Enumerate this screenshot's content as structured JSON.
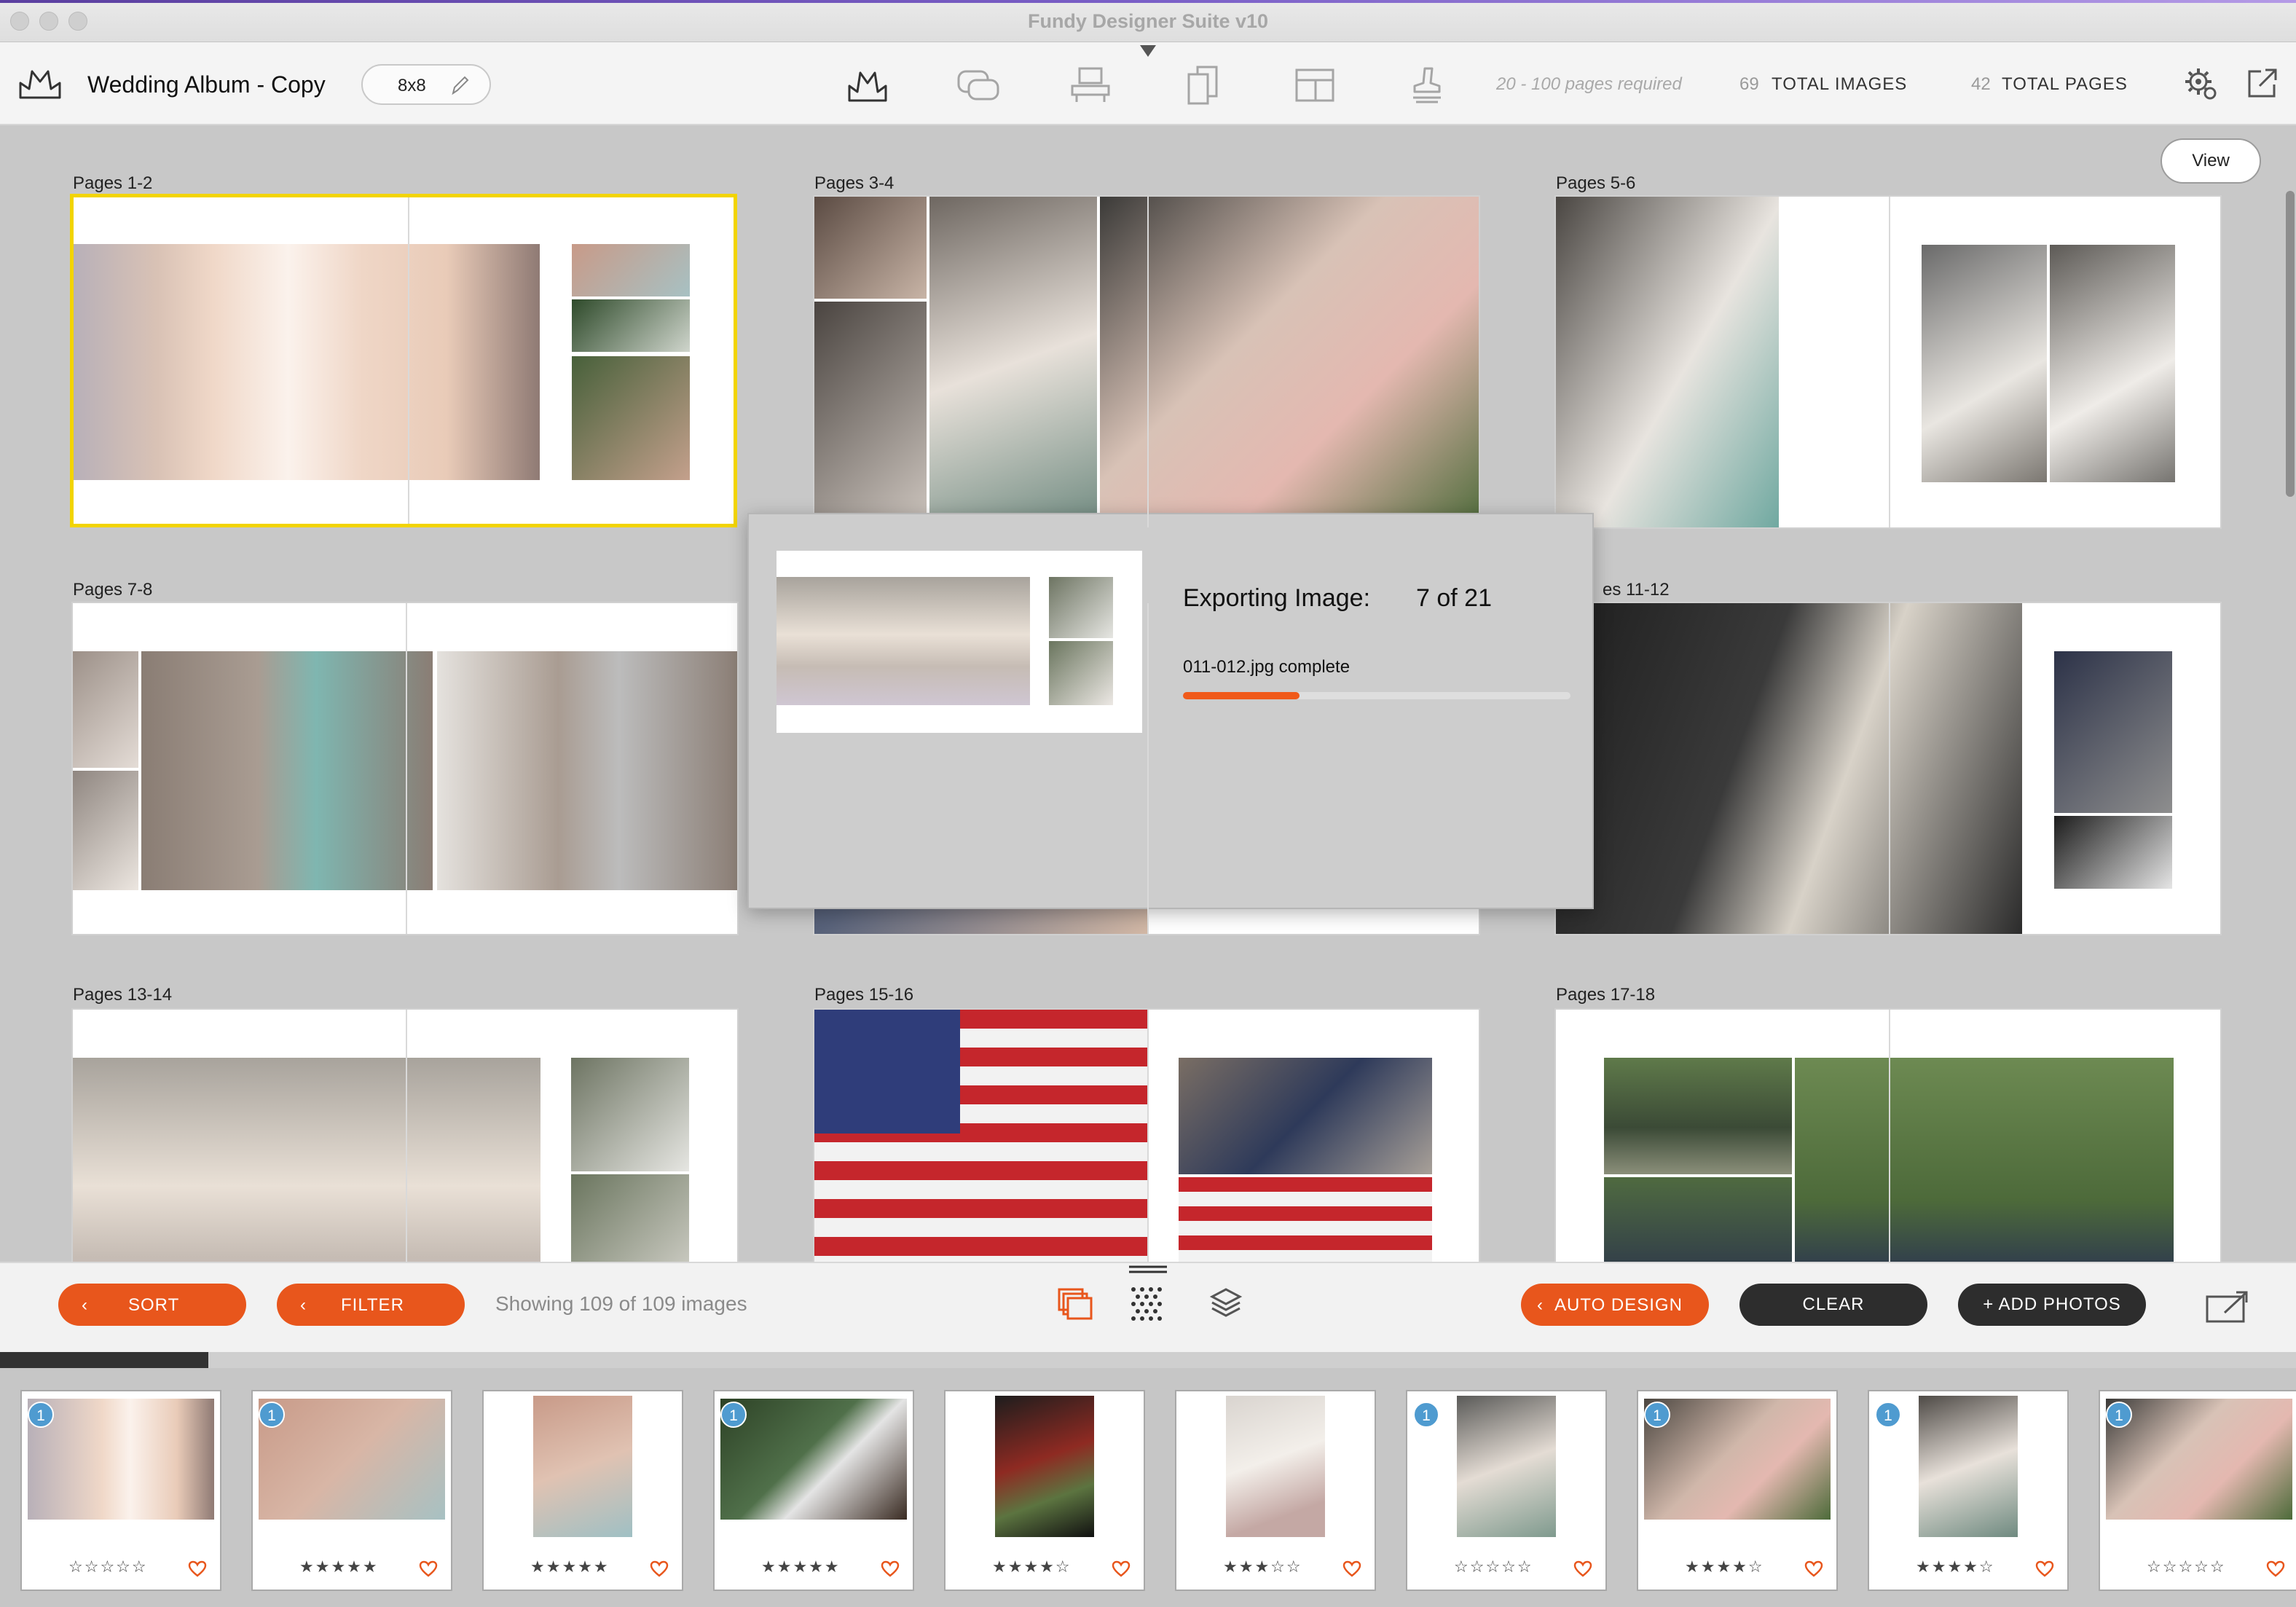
{
  "window": {
    "title": "Fundy Designer Suite v10"
  },
  "toolbar": {
    "project_title": "Wedding Album - Copy",
    "size_label": "8x8",
    "pages_required": "20 - 100 pages required",
    "total_images_count": "69",
    "total_images_label": "TOTAL IMAGES",
    "total_pages_count": "42",
    "total_pages_label": "TOTAL PAGES",
    "icons": [
      "album-icon",
      "proof-icon",
      "wall-icon",
      "cards-icon",
      "layout-icon",
      "stamp-icon"
    ]
  },
  "main": {
    "view_label": "View",
    "spreads": [
      {
        "label": "Pages 1-2"
      },
      {
        "label": "Pages 3-4"
      },
      {
        "label": "Pages 5-6"
      },
      {
        "label": "Pages 7-8"
      },
      {
        "label": ""
      },
      {
        "label": "es 11-12"
      },
      {
        "label": "Pages 13-14"
      },
      {
        "label": "Pages 15-16"
      },
      {
        "label": "Pages 17-18"
      }
    ]
  },
  "export_dialog": {
    "title": "Exporting Image:",
    "count": "7 of 21",
    "status": "011-012.jpg complete",
    "progress_fraction": 0.3
  },
  "controls": {
    "sort_label": "SORT",
    "filter_label": "FILTER",
    "showing_text": "Showing 109 of 109 images",
    "auto_design_label": "AUTO DESIGN",
    "clear_label": "CLEAR",
    "add_photos_label": "+ ADD PHOTOS"
  },
  "thumbnails": [
    {
      "badge": "1",
      "stars": "☆☆☆☆☆",
      "rating": 0
    },
    {
      "badge": "1",
      "stars": "★★★★★",
      "rating": 5
    },
    {
      "badge": "",
      "stars": "★★★★★",
      "rating": 5
    },
    {
      "badge": "1",
      "stars": "★★★★★",
      "rating": 5
    },
    {
      "badge": "",
      "stars": "★★★★☆",
      "rating": 4
    },
    {
      "badge": "",
      "stars": "★★★☆☆",
      "rating": 3
    },
    {
      "badge": "1",
      "stars": "☆☆☆☆☆",
      "rating": 0
    },
    {
      "badge": "1",
      "stars": "★★★★☆",
      "rating": 4
    },
    {
      "badge": "1",
      "stars": "★★★★☆",
      "rating": 4
    },
    {
      "badge": "1",
      "stars": "☆☆☆☆☆",
      "rating": 0
    }
  ],
  "colors": {
    "accent_orange": "#e8561c",
    "selection_yellow": "#f2d400",
    "badge_blue": "#4f9bd0",
    "dark_button": "#2d2d2d"
  }
}
